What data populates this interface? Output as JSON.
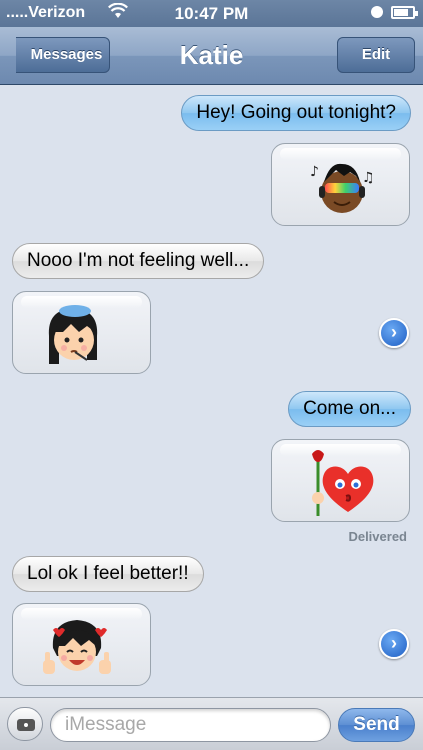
{
  "status_bar": {
    "carrier": ".....Verizon",
    "time": "10:47 PM"
  },
  "nav": {
    "back_label": "Messages",
    "title": "Katie",
    "edit_label": "Edit"
  },
  "messages": [
    {
      "direction": "outgoing",
      "text": "Hey! Going out tonight?"
    },
    {
      "direction": "outgoing",
      "media": "emoji-boy-headphones-sunglasses-icon"
    },
    {
      "direction": "incoming",
      "text": "Nooo I'm not feeling well..."
    },
    {
      "direction": "incoming",
      "media": "emoji-girl-ice-pack-thermometer-icon",
      "has_forward_button": true
    },
    {
      "direction": "outgoing",
      "text": "Come on..."
    },
    {
      "direction": "outgoing",
      "media": "emoji-heart-kiss-rose-icon",
      "status": "Delivered"
    },
    {
      "direction": "incoming",
      "text": "Lol ok I feel better!!"
    },
    {
      "direction": "incoming",
      "media": "emoji-girl-thumbs-up-hearts-icon",
      "has_forward_button": true
    }
  ],
  "input_bar": {
    "placeholder": "iMessage",
    "send_label": "Send"
  },
  "colors": {
    "nav_bar": "#7b96ba",
    "outgoing_bubble": "#8fc7f0",
    "incoming_bubble": "#e8e8e8",
    "background": "#dbe2ed",
    "send_button": "#5d8fd3"
  }
}
